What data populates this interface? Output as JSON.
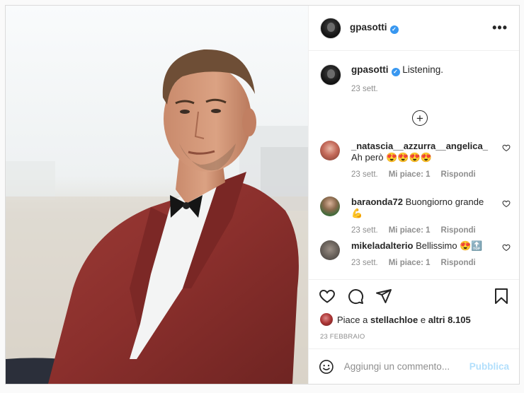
{
  "post": {
    "image_alt": "",
    "author": {
      "username": "gpasotti",
      "verified": true,
      "verified_mark": "✓"
    },
    "more_icon": "more-horizontal-icon",
    "more_label": "•••"
  },
  "caption": {
    "username": "gpasotti",
    "text": "Listening.",
    "time": "23 sett."
  },
  "load_more_icon": "plus-circle-icon",
  "load_more_label": "+",
  "comments": [
    {
      "username": "_natascia__azzurra__angelica_",
      "text": "Ah però 😍😍😍😍",
      "time": "23 sett.",
      "likes": "Mi piace: 1",
      "reply": "Rispondi"
    },
    {
      "username": "baraonda72",
      "text": "Buongiorno grande💪",
      "time": "23 sett.",
      "likes": "Mi piace: 1",
      "reply": "Rispondi"
    },
    {
      "username": "mikeladalterio",
      "text": "Bellissimo 😍🔝",
      "time": "23 sett.",
      "likes": "Mi piace: 1",
      "reply": "Rispondi"
    }
  ],
  "actions": {
    "icons": [
      "heart-icon",
      "comment-icon",
      "share-icon",
      "bookmark-icon"
    ]
  },
  "likes_line": {
    "prefix": "Piace a",
    "user": "stellachloe",
    "connector": "e",
    "others": "altri 8.105"
  },
  "date": "23 FEBBRAIO",
  "composer": {
    "emoji_icon": "emoji-icon",
    "placeholder": "Aggiungi un commento...",
    "publish_label": "Pubblica"
  },
  "colors": {
    "accent": "#3897f0",
    "publish_disabled": "#b2dffc",
    "muted": "#8e8e8e",
    "border": "#dbdbdb"
  }
}
